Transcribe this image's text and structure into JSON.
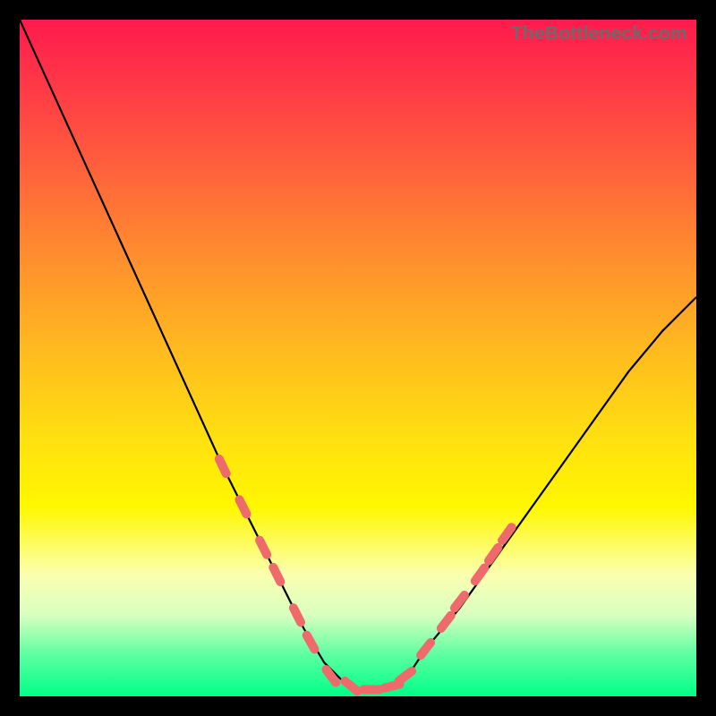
{
  "watermark": "TheBottleneck.com",
  "chart_data": {
    "type": "line",
    "title": "",
    "xlabel": "",
    "ylabel": "",
    "xlim": [
      0,
      100
    ],
    "ylim": [
      0,
      100
    ],
    "series": [
      {
        "name": "bottleneck-curve",
        "x": [
          0,
          5,
          10,
          15,
          20,
          25,
          30,
          35,
          40,
          42,
          45,
          48,
          50,
          52,
          54,
          56,
          58,
          60,
          65,
          70,
          75,
          80,
          85,
          90,
          95,
          100
        ],
        "values": [
          100,
          89,
          78,
          67,
          56,
          45,
          34,
          24,
          14,
          10,
          5,
          2,
          1,
          1,
          1,
          2,
          4,
          7,
          13,
          20,
          27,
          34,
          41,
          48,
          54,
          59
        ]
      }
    ],
    "markers": [
      {
        "name": "left-dot-1",
        "x": 30,
        "y": 34
      },
      {
        "name": "left-dot-2",
        "x": 33,
        "y": 28
      },
      {
        "name": "left-dot-3",
        "x": 36,
        "y": 22
      },
      {
        "name": "left-dot-4",
        "x": 38,
        "y": 18
      },
      {
        "name": "left-dot-5",
        "x": 41,
        "y": 12
      },
      {
        "name": "left-dot-6",
        "x": 43,
        "y": 8
      },
      {
        "name": "bottom-dot-1",
        "x": 46,
        "y": 3
      },
      {
        "name": "bottom-dot-2",
        "x": 49,
        "y": 1.5
      },
      {
        "name": "bottom-dot-3",
        "x": 52,
        "y": 1
      },
      {
        "name": "bottom-dot-4",
        "x": 55,
        "y": 1.5
      },
      {
        "name": "bottom-dot-5",
        "x": 57,
        "y": 3
      },
      {
        "name": "right-dot-1",
        "x": 60,
        "y": 7
      },
      {
        "name": "right-dot-2",
        "x": 63,
        "y": 11
      },
      {
        "name": "right-dot-3",
        "x": 65,
        "y": 14
      },
      {
        "name": "right-dot-4",
        "x": 68,
        "y": 18
      },
      {
        "name": "right-dot-5",
        "x": 70,
        "y": 21
      },
      {
        "name": "right-dot-6",
        "x": 72,
        "y": 24
      }
    ],
    "colors": {
      "curve": "#000000",
      "markers": "#ef6b6b",
      "gradient_top": "#ff1a4d",
      "gradient_mid": "#ffe010",
      "gradient_bottom": "#00ff88"
    }
  }
}
